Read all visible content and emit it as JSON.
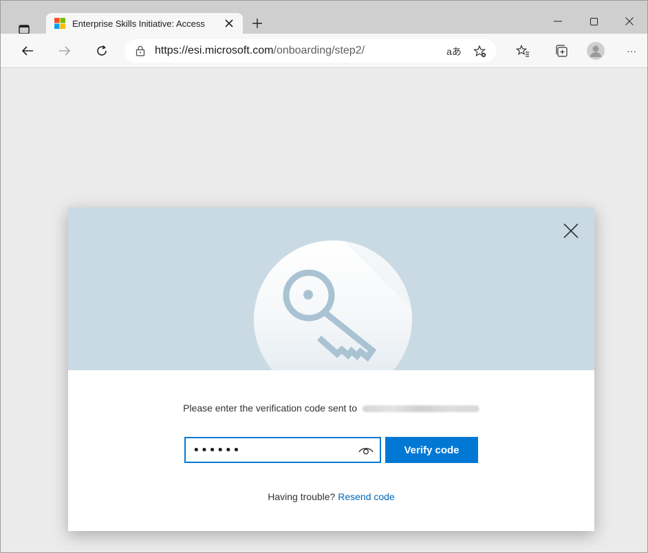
{
  "browser": {
    "tab_title": "Enterprise Skills Initiative: Access",
    "url_host": "https://esi.microsoft.com",
    "url_path": "/onboarding/step2/",
    "read_aloud_label": "aあ",
    "more_label": "···"
  },
  "dialog": {
    "prompt": "Please enter the verification code sent to",
    "code_value": "••••••",
    "verify_label": "Verify code",
    "trouble_text": "Having trouble?",
    "resend_label": "Resend code"
  },
  "colors": {
    "accent": "#0078d4",
    "hero_bg": "#c9dae4",
    "link": "#0067b8"
  }
}
